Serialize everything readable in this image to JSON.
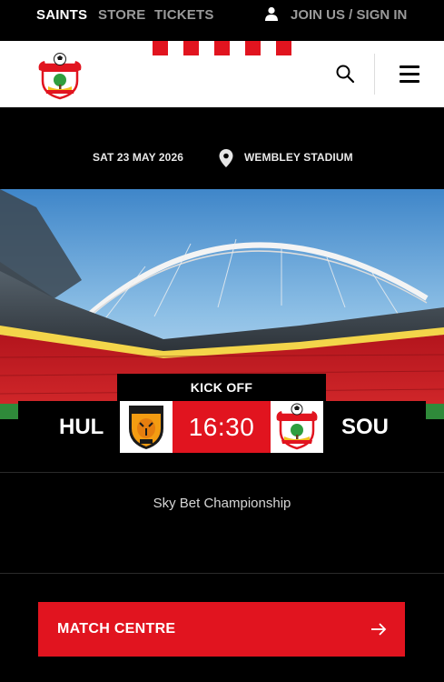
{
  "nav": {
    "links": [
      {
        "label": "SAINTS",
        "active": true
      },
      {
        "label": "STORE",
        "active": false
      },
      {
        "label": "TICKETS",
        "active": false
      }
    ],
    "account_label": "JOIN US / SIGN IN",
    "account_icon": "user-icon"
  },
  "header": {
    "logo": "southampton-crest",
    "search_icon": "search-icon",
    "menu_icon": "hamburger-menu-icon"
  },
  "match": {
    "date": "SAT 23 MAY 2026",
    "venue": "WEMBLEY STADIUM",
    "venue_icon": "location-pin-icon",
    "kickoff_label": "KICK OFF",
    "kickoff_time": "16:30",
    "home": {
      "code": "HUL",
      "badge": "hull-city-badge"
    },
    "away": {
      "code": "SOU",
      "badge": "southampton-badge"
    },
    "competition": "Sky Bet Championship"
  },
  "cta": {
    "label": "MATCH CENTRE",
    "icon": "arrow-right-icon"
  },
  "colors": {
    "accent": "#e1141f",
    "background": "#000000",
    "header_bg": "#ffffff"
  }
}
